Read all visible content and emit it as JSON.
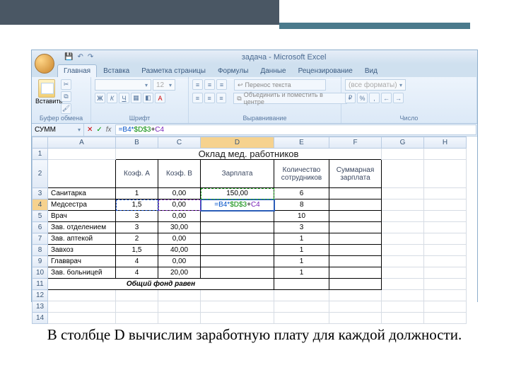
{
  "title": "задача - Microsoft Excel",
  "tabs": [
    "Главная",
    "Вставка",
    "Разметка страницы",
    "Формулы",
    "Данные",
    "Рецензирование",
    "Вид"
  ],
  "ribbon": {
    "paste": "Вставить",
    "clipboard": "Буфер обмена",
    "font": "Шрифт",
    "align": "Выравнивание",
    "number": "Число",
    "fontsize": "12",
    "wrap": "Перенос текста",
    "merge": "Объединить и поместить в центре",
    "numfmt": "(все форматы)"
  },
  "namebox": "СУММ",
  "formula_parts": {
    "b": "=B4*",
    "d": "$D$3",
    "plus": "+",
    "c": "C4"
  },
  "cols": [
    "A",
    "B",
    "C",
    "D",
    "E",
    "F",
    "G",
    "H"
  ],
  "sheet": {
    "title": "Оклад мед. работников",
    "headers": [
      "",
      "Коэф. A",
      "Коэф. B",
      "Зарплата",
      "Количество сотрудников",
      "Суммарная зарплата"
    ],
    "rows": [
      {
        "n": "3",
        "name": "Санитарка",
        "a": "1",
        "b": "0,00",
        "sal": "150,00",
        "cnt": "6"
      },
      {
        "n": "4",
        "name": "Медсестра",
        "a": "1,5",
        "b": "0,00",
        "sal": "=B4*$D$3+C4",
        "cnt": "8"
      },
      {
        "n": "5",
        "name": "Врач",
        "a": "3",
        "b": "0,00",
        "sal": "",
        "cnt": "10"
      },
      {
        "n": "6",
        "name": "Зав. отделением",
        "a": "3",
        "b": "30,00",
        "sal": "",
        "cnt": "3"
      },
      {
        "n": "7",
        "name": "Зав. аптекой",
        "a": "2",
        "b": "0,00",
        "sal": "",
        "cnt": "1"
      },
      {
        "n": "8",
        "name": "Завхоз",
        "a": "1,5",
        "b": "40,00",
        "sal": "",
        "cnt": "1"
      },
      {
        "n": "9",
        "name": "Главврач",
        "a": "4",
        "b": "0,00",
        "sal": "",
        "cnt": "1"
      },
      {
        "n": "10",
        "name": "Зав. больницей",
        "a": "4",
        "b": "20,00",
        "sal": "",
        "cnt": "1"
      }
    ],
    "footer": "Общий фонд равен"
  },
  "caption": "В столбце D вычислим заработную плату для каждой должности."
}
